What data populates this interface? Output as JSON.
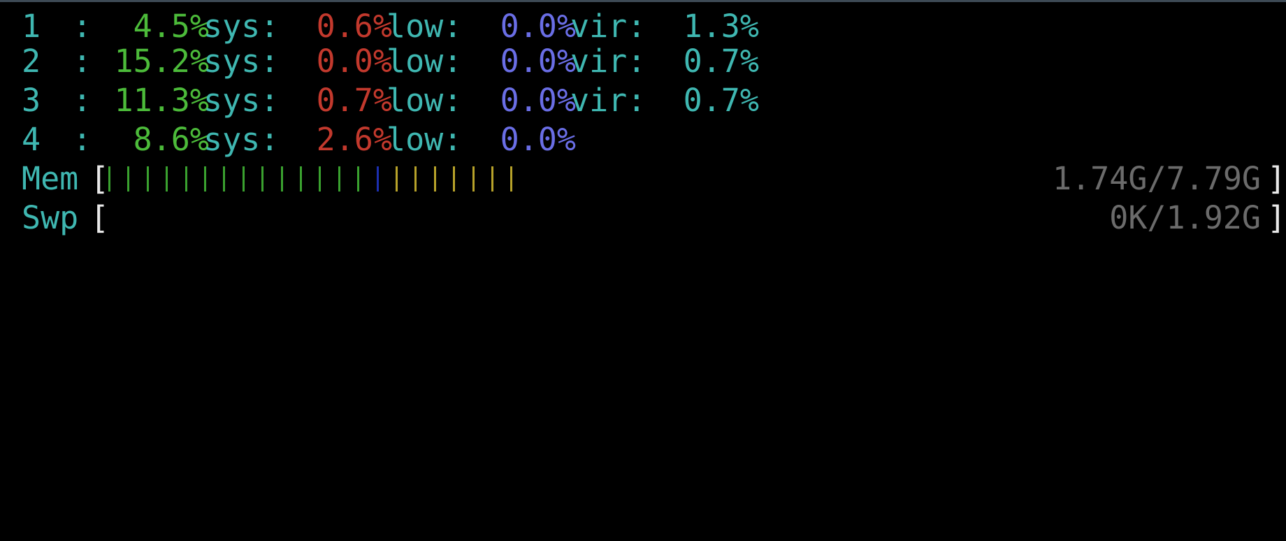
{
  "cpu_rows": [
    {
      "id": "1",
      "sep": ":",
      "user": "4.5%",
      "sys_label": "sys:",
      "sys": "0.6%",
      "low_label": "low:",
      "low": "0.0%",
      "vir_label": "vir:",
      "vir": "1.3%"
    },
    {
      "id": "2",
      "sep": ":",
      "user": "15.2%",
      "sys_label": "sys:",
      "sys": "0.0%",
      "low_label": "low:",
      "low": "0.0%",
      "vir_label": "vir:",
      "vir": "0.7%"
    },
    {
      "id": "3",
      "sep": ":",
      "user": "11.3%",
      "sys_label": "sys:",
      "sys": "0.7%",
      "low_label": "low:",
      "low": "0.0%",
      "vir_label": "vir:",
      "vir": "0.7%"
    },
    {
      "id": "4",
      "sep": ":",
      "user": "8.6%",
      "sys_label": "sys:",
      "sys": "2.6%",
      "low_label": "low:",
      "low": "0.0%"
    }
  ],
  "memory": {
    "label": "Mem",
    "open": "[",
    "close": "]",
    "value": "1.74G/7.79G",
    "bar_segments": {
      "green": 14,
      "blue": 1,
      "yellow": 7
    }
  },
  "swap": {
    "label": "Swp",
    "open": "[",
    "close": "]",
    "value": "0K/1.92G",
    "bar_segments": {
      "green": 0,
      "blue": 0,
      "yellow": 0
    }
  },
  "colors": {
    "label": "#3fb7b1",
    "user": "#4cbb3a",
    "sys": "#c3392d",
    "low": "#6a6ee6",
    "vir": "#3fb7b1",
    "bracket": "#e9e9e9",
    "meter_value": "#6b6b6b",
    "bar_green": "#3aa12f",
    "bar_blue": "#1c2fb0",
    "bar_yellow": "#b7a22a"
  }
}
